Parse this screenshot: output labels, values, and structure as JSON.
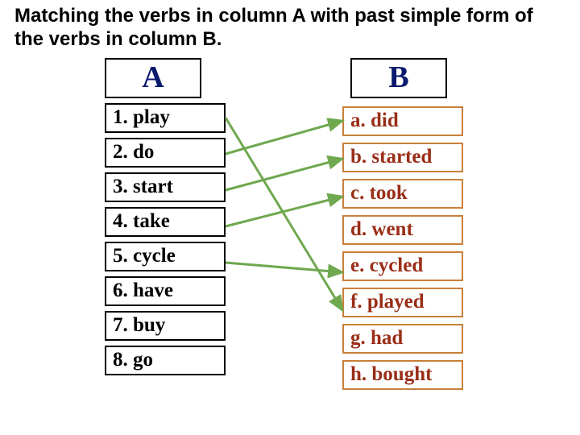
{
  "instruction": "Matching the verbs in column A with past simple form of the verbs in column B.",
  "headers": {
    "a": "A",
    "b": "B"
  },
  "columnA": [
    "1. play",
    "2. do",
    "3. start",
    "4. take",
    "5. cycle",
    "6. have",
    "7. buy",
    "8. go"
  ],
  "columnB": [
    "a. did",
    "b. started",
    "c. took",
    "d. went",
    "e. cycled",
    "f. played",
    "g. had",
    "h. bought"
  ],
  "matches": [
    {
      "from": 0,
      "to": 5
    },
    {
      "from": 1,
      "to": 0
    },
    {
      "from": 2,
      "to": 1
    },
    {
      "from": 3,
      "to": 2
    },
    {
      "from": 4,
      "to": 4
    }
  ]
}
